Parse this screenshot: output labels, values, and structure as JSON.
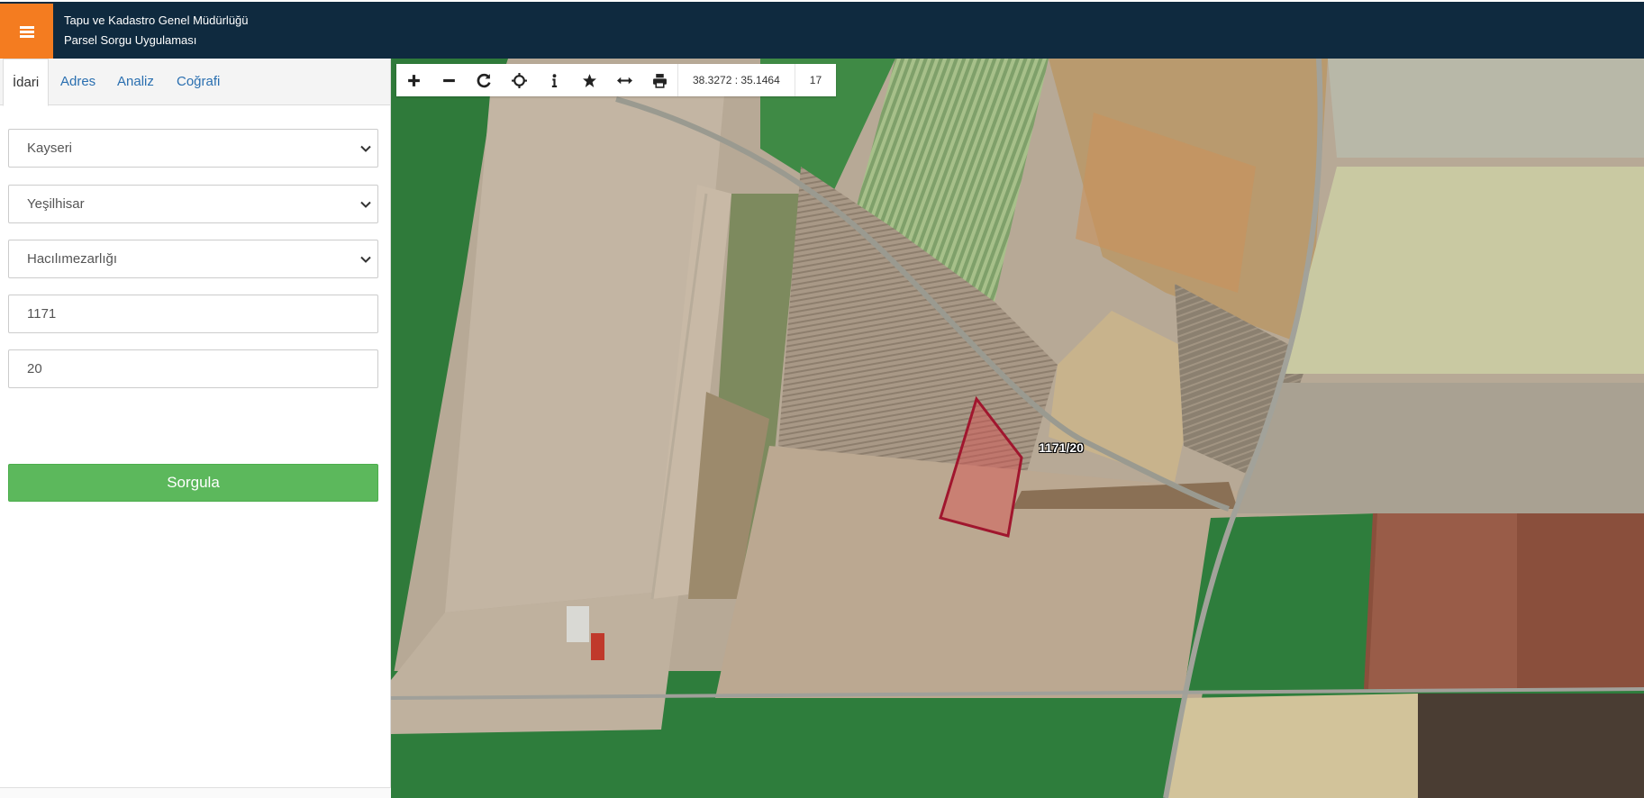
{
  "header": {
    "title_line1": "Tapu ve Kadastro Genel Müdürlüğü",
    "title_line2": "Parsel Sorgu Uygulaması",
    "menu_icon": "hamburger-icon",
    "bg_color": "#0f2a3f",
    "menu_color": "#f47c20"
  },
  "sidebar": {
    "tabs": [
      {
        "label": "İdari",
        "active": true
      },
      {
        "label": "Adres",
        "active": false
      },
      {
        "label": "Analiz",
        "active": false
      },
      {
        "label": "Coğrafi",
        "active": false
      }
    ],
    "province": "Kayseri",
    "district": "Yeşilhisar",
    "neighborhood": "Hacılımezarlığı",
    "block": "1171",
    "parcel": "20",
    "submit_label": "Sorgula",
    "submit_color": "#5cb85c"
  },
  "map": {
    "toolbar": {
      "buttons": [
        "zoom-in-icon",
        "zoom-out-icon",
        "refresh-icon",
        "locate-icon",
        "info-icon",
        "star-icon",
        "measure-icon",
        "print-icon"
      ],
      "coordinates": "38.3272 : 35.1464",
      "zoom_level": "17"
    },
    "parcel_label": "1171/20",
    "parcel_color": "#a0162e"
  }
}
